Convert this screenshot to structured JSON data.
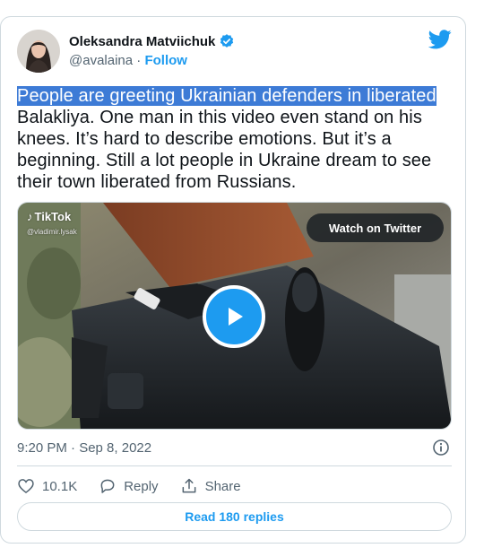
{
  "author": {
    "name": "Oleksandra Matviichuk",
    "handle": "@avalaina",
    "separator": "·",
    "follow_label": "Follow"
  },
  "tweet": {
    "text_highlighted": "People are greeting Ukrainian defenders in liberated",
    "text_rest": " Balakliya. One man in this video even stand on his knees. It’s hard to describe emotions. But it’s a beginning. Still a lot people in Ukraine dream to see their town liberated from Russians."
  },
  "media": {
    "watermark_brand": "TikTok",
    "watermark_handle": "@vladimir.lysak",
    "watch_label": "Watch on Twitter"
  },
  "meta": {
    "timestamp": "9:20 PM · Sep 8, 2022"
  },
  "actions": {
    "like_count": "10.1K",
    "reply_label": "Reply",
    "share_label": "Share"
  },
  "replies_button_label": "Read 180 replies",
  "colors": {
    "accent": "#1d9bf0",
    "highlight": "#3d7bd6",
    "text": "#0f1419",
    "secondary": "#536471"
  }
}
